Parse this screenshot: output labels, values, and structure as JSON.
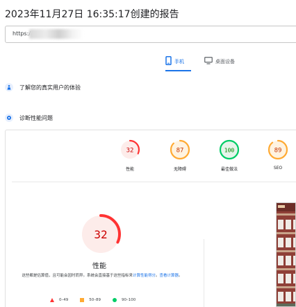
{
  "report": {
    "title": "2023年11月27日 16:35:17创建的报告",
    "url_value": "https://cr"
  },
  "device_tabs": [
    {
      "label": "手机",
      "icon": "mobile-phone-icon",
      "selected": true
    },
    {
      "label": "桌面设备",
      "icon": "desktop-monitor-icon",
      "selected": false
    }
  ],
  "sections": {
    "field_data": "了解您的真实用户的体验",
    "lab_data": "诊断性能问题"
  },
  "gauges": [
    {
      "score": "32",
      "label": "性能",
      "color": "#ff3333",
      "fill": "#fdecea",
      "fraction": 0.32
    },
    {
      "score": "87",
      "label": "无障碍",
      "color": "#ffaa33",
      "fill": "#fff3e0",
      "fraction": 0.87
    },
    {
      "score": "100",
      "label": "最佳做法",
      "color": "#00cc66",
      "fill": "#e6f4ea",
      "fraction": 1.0
    },
    {
      "score": "89",
      "label": "SEO",
      "color": "#ffaa33",
      "fill": "#fff3e0",
      "fraction": 0.89
    }
  ],
  "performance": {
    "score": "32",
    "label": "性能",
    "fraction": 0.32,
    "color": "#ff3333",
    "desc_text": "这些都是估算值，且可能会因时而异。系统会直接基于这些指标来",
    "desc_link1": "计算性能得分",
    "desc_sep": "。",
    "desc_link2": "查看计算器",
    "desc_end": "。"
  },
  "legend": [
    {
      "range": "0–49",
      "shape": "triangle",
      "color": "#ff3333"
    },
    {
      "range": "50–89",
      "shape": "square",
      "color": "#ffaa33"
    },
    {
      "range": "90–100",
      "shape": "circle",
      "color": "#00cc66"
    }
  ]
}
